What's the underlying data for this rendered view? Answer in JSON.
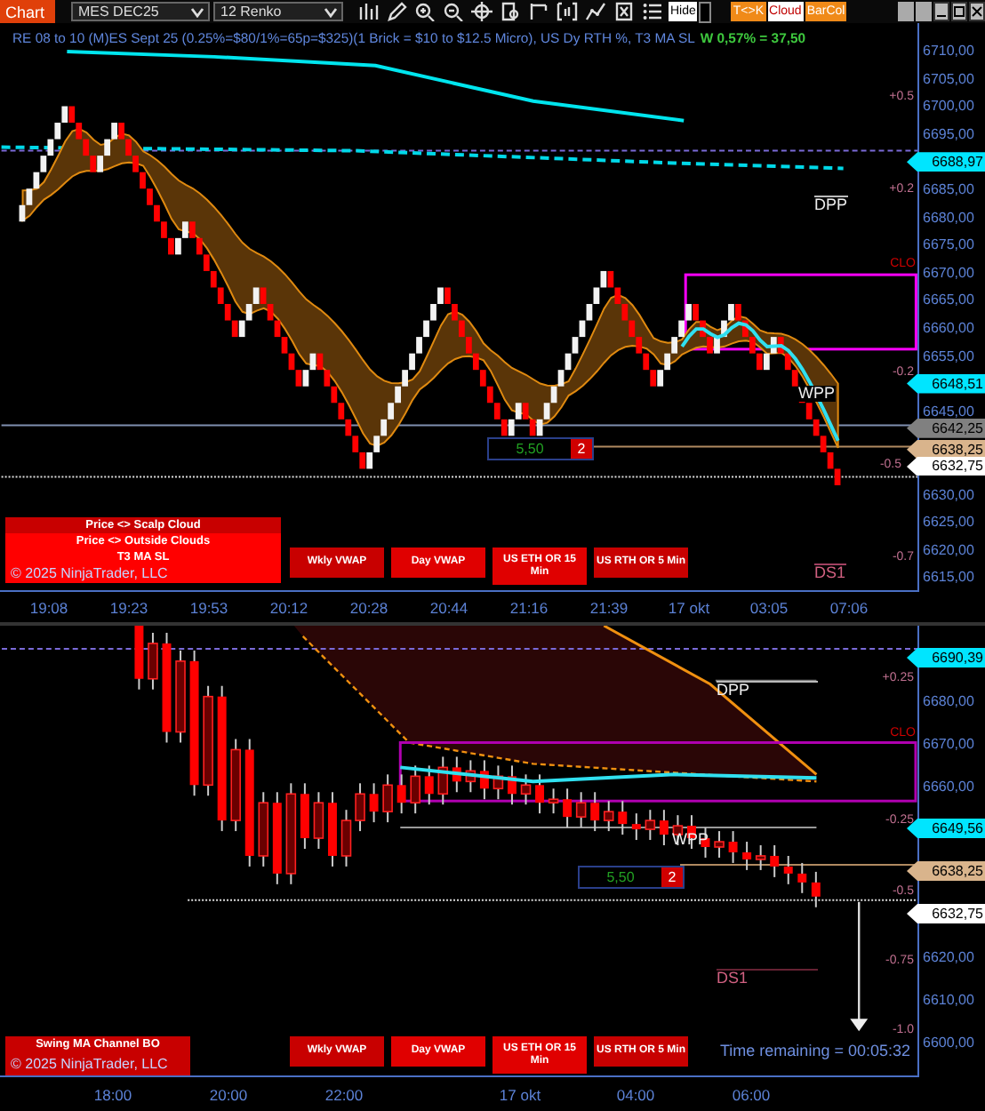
{
  "toolbar": {
    "chart_button": "Chart",
    "instrument": "MES DEC25",
    "bar_type": "12 Renko",
    "toggles": [
      {
        "label": "Hide",
        "kind": "switch",
        "color": "#ffffff",
        "on": false
      },
      {
        "label": "T<>K",
        "kind": "button",
        "color": "#f08a18"
      },
      {
        "label": "Cloud",
        "kind": "button",
        "color": "#ffffff"
      },
      {
        "label": "BarCol",
        "kind": "button",
        "color": "#f08a18"
      }
    ]
  },
  "top_pane": {
    "title": "RE 08 to 10 (M)ES Sept 25 (0.25%=$80/1%=65p=$325)(1 Brick = $10 to $12.5 Micro), US Dy RTH %, T3 MA SL",
    "pnl": "W 0,57% = 37,50",
    "levels": [
      {
        "label": "+0.5",
        "kind": "percent"
      },
      {
        "label": "+0.2",
        "kind": "percent"
      },
      {
        "label": "DPP",
        "kind": "pivot"
      },
      {
        "label": "CLO",
        "kind": "close"
      },
      {
        "label": "-0.2",
        "kind": "percent"
      },
      {
        "label": "WPP",
        "kind": "pivot"
      },
      {
        "label": "-0.5",
        "kind": "percent"
      },
      {
        "label": "-0.7",
        "kind": "percent"
      },
      {
        "label": "DS1",
        "kind": "support"
      }
    ],
    "position_box": {
      "value": "5,50",
      "quantity": "2"
    },
    "panel": {
      "rows": [
        {
          "label": "Price <> Scalp Cloud",
          "color": "#c80000"
        },
        {
          "label": "Price <> Outside Clouds",
          "color": "#ff0000"
        },
        {
          "label": "T3 MA SL",
          "color": "#ff0000"
        }
      ],
      "copyright": "© 2025 NinjaTrader, LLC"
    },
    "buttons": [
      {
        "label": "Wkly VWAP",
        "color": "#c80000"
      },
      {
        "label": "Day VWAP",
        "color": "#e00000"
      },
      {
        "label": "US ETH OR 15 Min",
        "color": "#e00000"
      },
      {
        "label": "US RTH OR 5 Min",
        "color": "#c80000"
      }
    ],
    "price_axis": [
      {
        "label": "6710,00"
      },
      {
        "label": "6705,00"
      },
      {
        "label": "6700,00"
      },
      {
        "label": "6695,00"
      },
      {
        "tags": [
          {
            "label": "6688,97",
            "color": "#00e5ff"
          }
        ]
      },
      {
        "label": "6685,00"
      },
      {
        "label": "6680,00"
      },
      {
        "label": "6675,00"
      },
      {
        "label": "6670,00"
      },
      {
        "label": "6665,00"
      },
      {
        "label": "6660,00"
      },
      {
        "label": "6655,00"
      },
      {
        "tags": [
          {
            "label": "6648,51",
            "color": "#00e5ff"
          }
        ]
      },
      {
        "label": "6645,00"
      },
      {
        "tags": [
          {
            "label": "6642,25",
            "color": "#808080"
          },
          {
            "label": "6638,25",
            "color": "#d9b48c"
          }
        ]
      },
      {
        "tags": [
          {
            "label": "6632,75",
            "color": "#ffffff"
          }
        ]
      },
      {
        "label": "6630,00"
      },
      {
        "label": "6625,00"
      },
      {
        "label": "6620,00"
      },
      {
        "label": "6615,00"
      }
    ],
    "time_axis": [
      "19:08",
      "19:23",
      "19:53",
      "20:12",
      "20:28",
      "20:44",
      "21:16",
      "21:39",
      "17 okt",
      "03:05",
      "07:06"
    ]
  },
  "bottom_pane": {
    "levels": [
      {
        "label": "+0.25",
        "kind": "percent"
      },
      {
        "label": "DPP",
        "kind": "pivot"
      },
      {
        "label": "CLO",
        "kind": "close"
      },
      {
        "label": "-0.25",
        "kind": "percent"
      },
      {
        "label": "WPP",
        "kind": "pivot"
      },
      {
        "label": "-0.5",
        "kind": "percent"
      },
      {
        "label": "-0.75",
        "kind": "percent"
      },
      {
        "label": "DS1",
        "kind": "support"
      },
      {
        "label": "-1.0",
        "kind": "percent"
      }
    ],
    "position_box": {
      "value": "5,50",
      "quantity": "2"
    },
    "panel": {
      "rows": [
        {
          "label": "Swing MA Channel BO",
          "color": "#c80000"
        }
      ],
      "copyright": "© 2025 NinjaTrader, LLC"
    },
    "buttons": [
      {
        "label": "Wkly VWAP",
        "color": "#c80000"
      },
      {
        "label": "Day VWAP",
        "color": "#e00000"
      },
      {
        "label": "US ETH OR 15 Min",
        "color": "#e00000"
      },
      {
        "label": "US RTH OR 5 Min",
        "color": "#c80000"
      }
    ],
    "time_remaining": "Time remaining = 00:05:32",
    "price_axis": [
      {
        "tags": [
          {
            "label": "6690,39",
            "color": "#00e5ff"
          }
        ]
      },
      {
        "label": "6680,00"
      },
      {
        "label": "6670,00"
      },
      {
        "label": "6660,00"
      },
      {
        "tags": [
          {
            "label": "6649,56",
            "color": "#00e5ff"
          }
        ]
      },
      {
        "tags": [
          {
            "label": "6638,25",
            "color": "#d9b48c"
          }
        ]
      },
      {
        "tags": [
          {
            "label": "6632,75",
            "color": "#ffffff"
          }
        ]
      },
      {
        "label": "6620,00"
      },
      {
        "label": "6610,00"
      },
      {
        "label": "6600,00"
      }
    ],
    "time_axis": [
      "18:00",
      "20:00",
      "22:00",
      "17 okt",
      "04:00",
      "06:00"
    ]
  }
}
